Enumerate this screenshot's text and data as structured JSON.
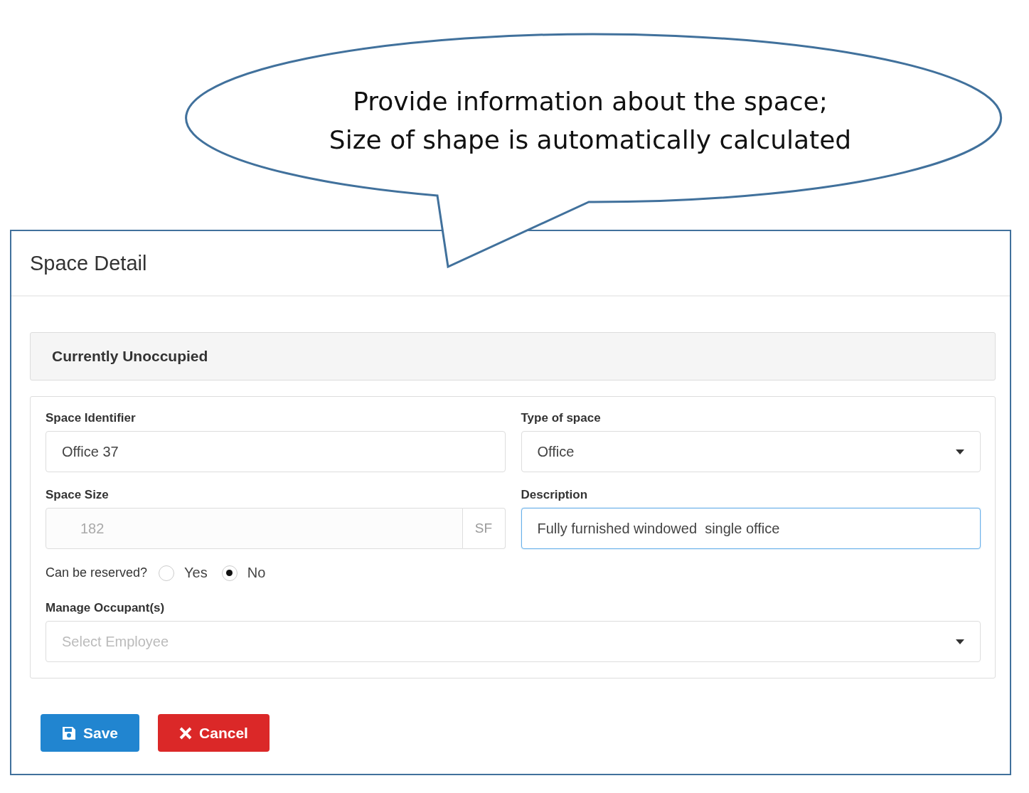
{
  "callout": {
    "lines": [
      "Provide information about the space;",
      "Size of shape is automatically calculated"
    ]
  },
  "panel": {
    "title": "Space Detail",
    "status": "Currently Unoccupied",
    "fields": [
      {
        "kind": "text",
        "label": "Space Identifier",
        "value": "Office 37",
        "disabled": false,
        "focused": false
      },
      {
        "kind": "select",
        "label": "Type of space",
        "value": "Office",
        "disabled": false,
        "focused": false
      },
      {
        "kind": "addon",
        "label": "Space Size",
        "value": "182",
        "addon": "SF",
        "disabled": true,
        "focused": false
      },
      {
        "kind": "text",
        "label": "Description",
        "value": "Fully furnished windowed  single office",
        "disabled": false,
        "focused": true
      }
    ],
    "reservable": {
      "label": "Can be reserved?",
      "options": [
        {
          "label": "Yes",
          "selected": false
        },
        {
          "label": "No",
          "selected": true
        }
      ]
    },
    "occupants": {
      "label": "Manage Occupant(s)",
      "placeholder": "Select Employee"
    },
    "buttons": [
      {
        "kind": "save",
        "label": "Save"
      },
      {
        "kind": "cancel",
        "label": "Cancel"
      }
    ]
  }
}
